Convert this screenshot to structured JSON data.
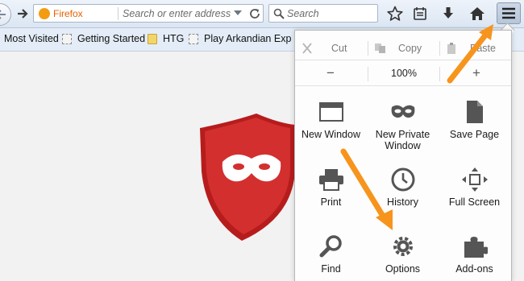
{
  "browser": "Firefox",
  "url_bar": {
    "identity_label": "Firefox",
    "placeholder": "Search or enter address"
  },
  "search_bar": {
    "placeholder": "Search"
  },
  "toolbar_icons": [
    "back-icon",
    "forward-icon",
    "dropdown-icon",
    "reload-icon",
    "search-icon",
    "star-icon",
    "reading-list-icon",
    "download-icon",
    "home-icon",
    "hamburger-menu-icon"
  ],
  "bookmarks": [
    {
      "label": "Most Visited",
      "icon": ""
    },
    {
      "label": "Getting Started",
      "icon": "page-icon"
    },
    {
      "label": "HTG",
      "icon": "folder-icon"
    },
    {
      "label": "Play Arkandian Exp",
      "icon": "page-icon"
    }
  ],
  "menu": {
    "edit": {
      "cut": "Cut",
      "copy": "Copy",
      "paste": "Paste"
    },
    "zoom": {
      "minus": "−",
      "level": "100%",
      "plus": "+"
    },
    "items": [
      {
        "label": "New Window",
        "icon": "new-window-icon"
      },
      {
        "label": "New Private Window",
        "icon": "private-mask-icon"
      },
      {
        "label": "Save Page",
        "icon": "save-page-icon"
      },
      {
        "label": "Print",
        "icon": "printer-icon"
      },
      {
        "label": "History",
        "icon": "clock-icon"
      },
      {
        "label": "Full Screen",
        "icon": "fullscreen-icon"
      },
      {
        "label": "Find",
        "icon": "magnifier-icon"
      },
      {
        "label": "Options",
        "icon": "gear-icon"
      },
      {
        "label": "Add-ons",
        "icon": "puzzle-icon"
      }
    ]
  },
  "colors": {
    "accent_orange": "#f7941d",
    "shield_red": "#d32f2f",
    "toolbar_blue": "#dbe6f3",
    "menu_bg": "#fdfdfd"
  }
}
